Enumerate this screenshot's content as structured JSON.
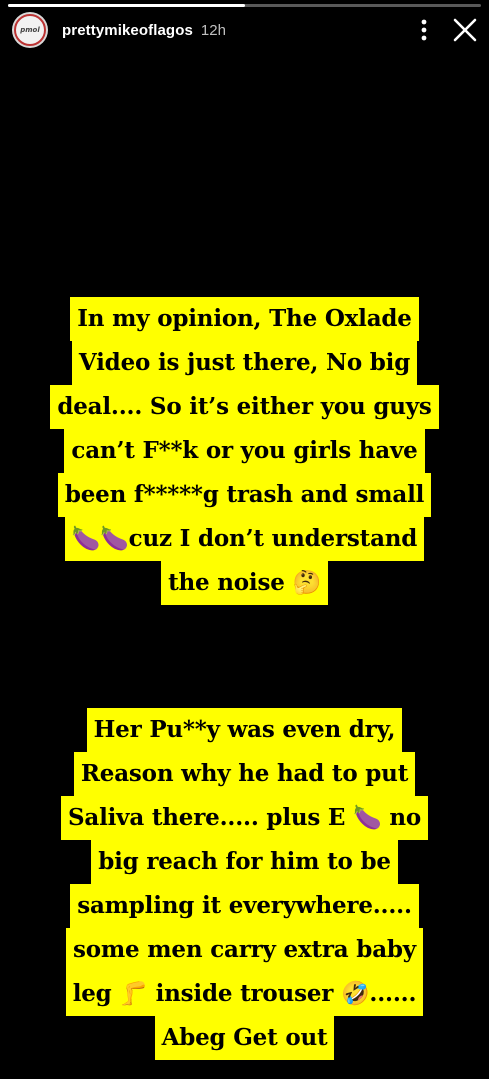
{
  "story": {
    "username": "prettymikeoflagos",
    "time": "12h",
    "avatar_text": "pmol",
    "progress": 0.5
  },
  "caption1": {
    "lines": [
      "In my opinion, The Oxlade",
      "Video is just there, No big",
      "deal.... So it’s either you guys",
      "can’t F**k or you girls have",
      "been f*****g trash and small",
      "🍆🍆cuz I don’t understand",
      "the noise 🤔"
    ]
  },
  "caption2": {
    "lines": [
      "Her Pu**y was even dry,",
      "Reason why he had to put",
      "Saliva there..... plus E 🍆 no",
      "big reach for him to be",
      "sampling it everywhere.....",
      "some men carry extra baby",
      "leg 🦵 inside trouser 🤣......",
      "Abeg Get out"
    ]
  },
  "colors": {
    "highlight": "#ffff00",
    "background": "#000000"
  },
  "icons": [
    "more-options-icon",
    "close-icon"
  ]
}
